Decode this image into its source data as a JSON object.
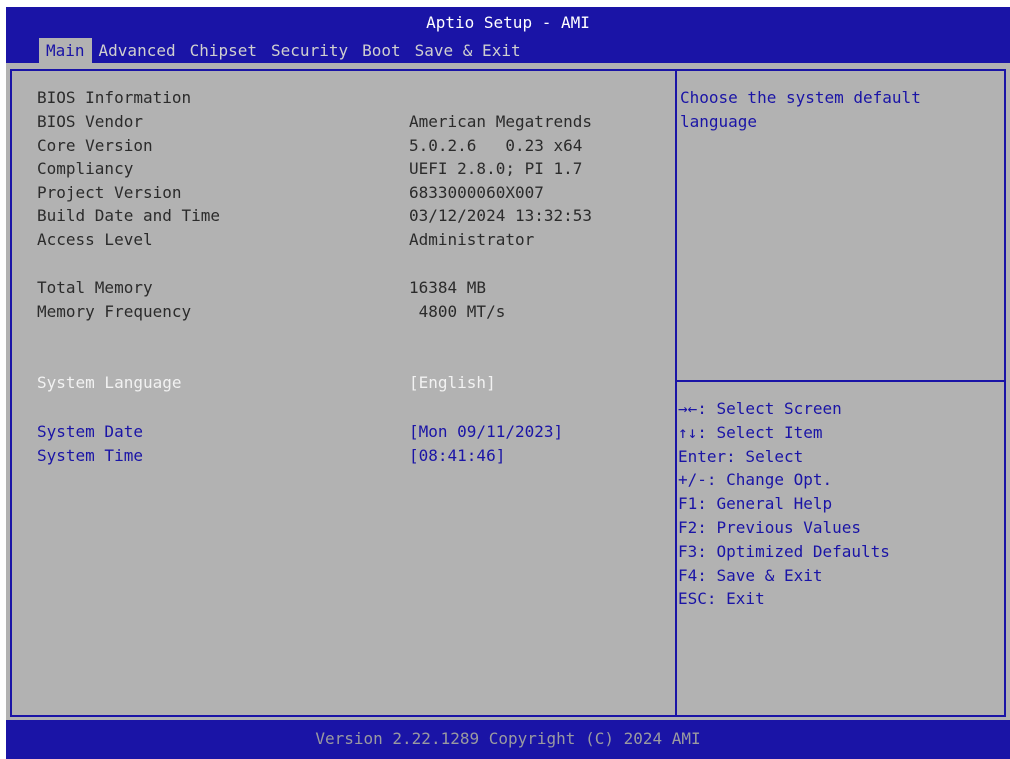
{
  "title": "Aptio Setup - AMI",
  "tabs": [
    {
      "label": "Main",
      "active": true
    },
    {
      "label": "Advanced",
      "active": false
    },
    {
      "label": "Chipset",
      "active": false
    },
    {
      "label": "Security",
      "active": false
    },
    {
      "label": "Boot",
      "active": false
    },
    {
      "label": "Save & Exit",
      "active": false
    }
  ],
  "info": {
    "header": "BIOS Information",
    "rows": [
      {
        "label": "BIOS Vendor",
        "value": "American Megatrends"
      },
      {
        "label": "Core Version",
        "value": "5.0.2.6   0.23 x64"
      },
      {
        "label": "Compliancy",
        "value": "UEFI 2.8.0; PI 1.7"
      },
      {
        "label": "Project Version",
        "value": "6833000060X007"
      },
      {
        "label": "Build Date and Time",
        "value": "03/12/2024 13:32:53"
      },
      {
        "label": "Access Level",
        "value": "Administrator"
      }
    ],
    "memory": [
      {
        "label": "Total Memory",
        "value": "16384 MB"
      },
      {
        "label": "Memory Frequency",
        "value": " 4800 MT/s"
      }
    ]
  },
  "settings": {
    "language": {
      "label": "System Language",
      "value": "[English]"
    },
    "date": {
      "label": "System Date",
      "value": "[Mon 09/11/2023]"
    },
    "time": {
      "label": "System Time",
      "value": "[08:41:46]"
    }
  },
  "help": {
    "description": [
      "Choose the system default",
      "language"
    ],
    "keys": [
      "→←: Select Screen",
      "↑↓: Select Item",
      "Enter: Select",
      "+/-: Change Opt.",
      "F1: General Help",
      "F2: Previous Values",
      "F3: Optimized Defaults",
      "F4: Save & Exit",
      "ESC: Exit"
    ]
  },
  "footer": "Version 2.22.1289 Copyright (C) 2024 AMI",
  "colors": {
    "accent": "#1a14a6",
    "background": "#b2b2b2"
  }
}
